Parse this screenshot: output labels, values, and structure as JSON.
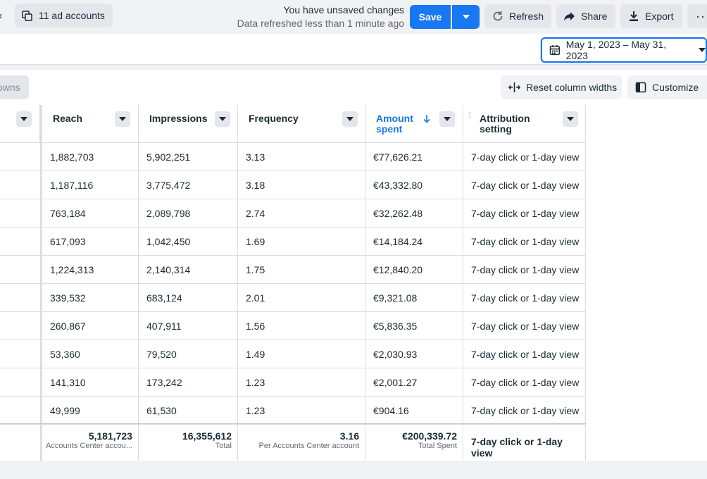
{
  "toolbar": {
    "accounts_label": "11 ad accounts",
    "unsaved_line1": "You have unsaved changes",
    "unsaved_line2": "Data refreshed less than 1 minute ago",
    "save_label": "Save",
    "refresh_label": "Refresh",
    "share_label": "Share",
    "export_label": "Export",
    "more_label": "···"
  },
  "date_range": {
    "label": "May 1, 2023 – May 31, 2023"
  },
  "table_tools": {
    "breakdowns_label": "owns",
    "reset_label": "Reset column widths",
    "customize_label": "Customize"
  },
  "columns": [
    {
      "key": "reach",
      "label": "Reach",
      "sorted": false
    },
    {
      "key": "impressions",
      "label": "Impressions",
      "sorted": false
    },
    {
      "key": "frequency",
      "label": "Frequency",
      "sorted": false
    },
    {
      "key": "amount_spent",
      "label": "Amount spent",
      "sorted": true,
      "sort_direction": "descending"
    },
    {
      "key": "attribution",
      "label": "Attribution setting",
      "sorted": false
    }
  ],
  "rows": [
    {
      "reach": "1,882,703",
      "impressions": "5,902,251",
      "frequency": "3.13",
      "amount_spent": "€77,626.21",
      "attribution": "7-day click or 1-day view"
    },
    {
      "reach": "1,187,116",
      "impressions": "3,775,472",
      "frequency": "3.18",
      "amount_spent": "€43,332.80",
      "attribution": "7-day click or 1-day view"
    },
    {
      "reach": "763,184",
      "impressions": "2,089,798",
      "frequency": "2.74",
      "amount_spent": "€32,262.48",
      "attribution": "7-day click or 1-day view"
    },
    {
      "reach": "617,093",
      "impressions": "1,042,450",
      "frequency": "1.69",
      "amount_spent": "€14,184.24",
      "attribution": "7-day click or 1-day view"
    },
    {
      "reach": "1,224,313",
      "impressions": "2,140,314",
      "frequency": "1.75",
      "amount_spent": "€12,840.20",
      "attribution": "7-day click or 1-day view"
    },
    {
      "reach": "339,532",
      "impressions": "683,124",
      "frequency": "2.01",
      "amount_spent": "€9,321.08",
      "attribution": "7-day click or 1-day view"
    },
    {
      "reach": "260,867",
      "impressions": "407,911",
      "frequency": "1.56",
      "amount_spent": "€5,836.35",
      "attribution": "7-day click or 1-day view"
    },
    {
      "reach": "53,360",
      "impressions": "79,520",
      "frequency": "1.49",
      "amount_spent": "€2,030.93",
      "attribution": "7-day click or 1-day view"
    },
    {
      "reach": "141,310",
      "impressions": "173,242",
      "frequency": "1.23",
      "amount_spent": "€2,001.27",
      "attribution": "7-day click or 1-day view"
    },
    {
      "reach": "49,999",
      "impressions": "61,530",
      "frequency": "1.23",
      "amount_spent": "€904.16",
      "attribution": "7-day click or 1-day view"
    }
  ],
  "totals": {
    "reach": {
      "value": "5,181,723",
      "sub": "Accounts Center accou..."
    },
    "impressions": {
      "value": "16,355,612",
      "sub": "Total"
    },
    "frequency": {
      "value": "3.16",
      "sub": "Per Accounts Center account"
    },
    "amount_spent": {
      "value": "€200,339.72",
      "sub": "Total Spent"
    },
    "attribution": {
      "value": "7-day click or 1-day view"
    }
  },
  "colors": {
    "accent": "#1877f2",
    "border": "#dadde1",
    "text": "#1c2b33",
    "muted": "#65676b"
  }
}
